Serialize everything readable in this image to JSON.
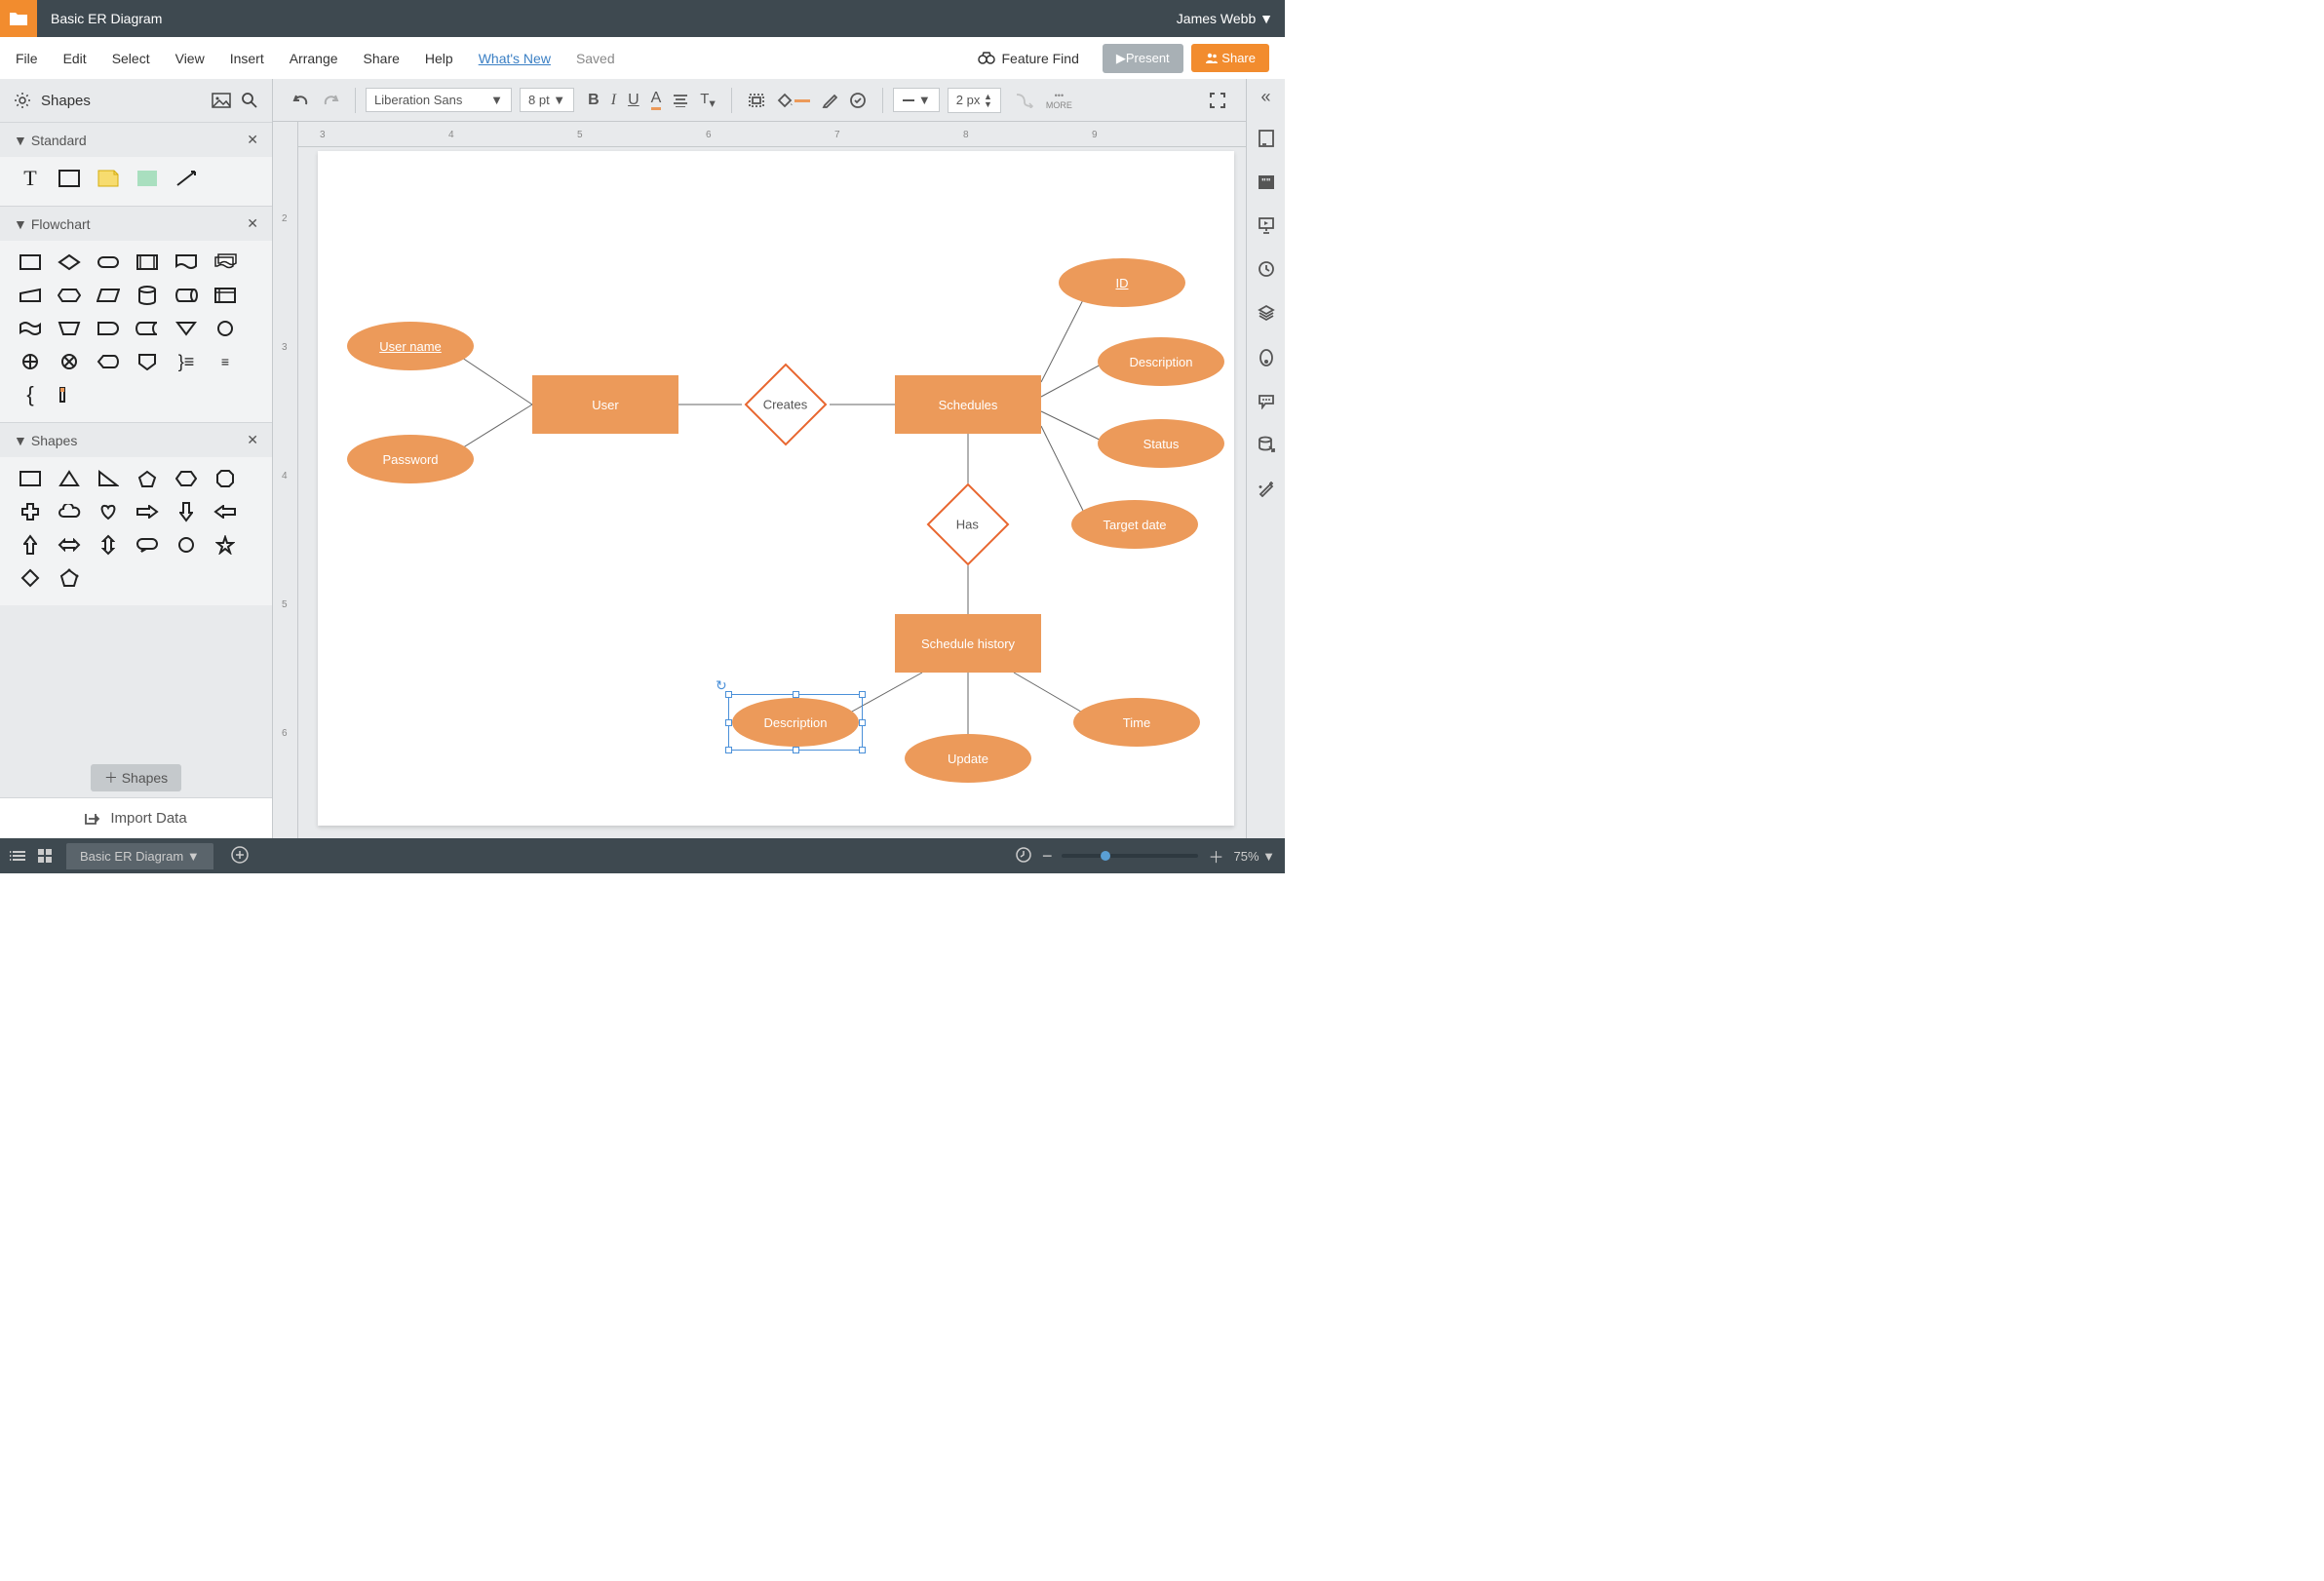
{
  "header": {
    "title": "Basic ER Diagram",
    "user": "James Webb"
  },
  "menu": {
    "file": "File",
    "edit": "Edit",
    "select": "Select",
    "view": "View",
    "insert": "Insert",
    "arrange": "Arrange",
    "share": "Share",
    "help": "Help",
    "whatsnew": "What's New",
    "saved": "Saved",
    "feature_find": "Feature Find",
    "present": "Present",
    "share_btn": "Share"
  },
  "sidebar": {
    "shapes_label": "Shapes",
    "panels": {
      "standard": "Standard",
      "flowchart": "Flowchart",
      "shapes": "Shapes"
    },
    "shapes_btn": "Shapes",
    "import": "Import Data"
  },
  "toolbar": {
    "font": "Liberation Sans",
    "font_size": "8 pt",
    "stroke_width": "2 px",
    "more": "MORE"
  },
  "right_dock": {
    "collapse": "«"
  },
  "diagram": {
    "nodes": {
      "user_name": "User name",
      "password": "Password",
      "user": "User",
      "creates": "Creates",
      "schedules": "Schedules",
      "has": "Has",
      "id": "ID",
      "description_attr": "Description",
      "status": "Status",
      "target_date": "Target date",
      "schedule_history": "Schedule history",
      "description_hist": "Description",
      "update": "Update",
      "time": "Time"
    }
  },
  "ruler": {
    "h": [
      "3",
      "4",
      "5",
      "6",
      "7",
      "8",
      "9"
    ],
    "v": [
      "2",
      "3",
      "4",
      "5",
      "6"
    ]
  },
  "status": {
    "tab": "Basic ER Diagram",
    "zoom": "75%"
  }
}
